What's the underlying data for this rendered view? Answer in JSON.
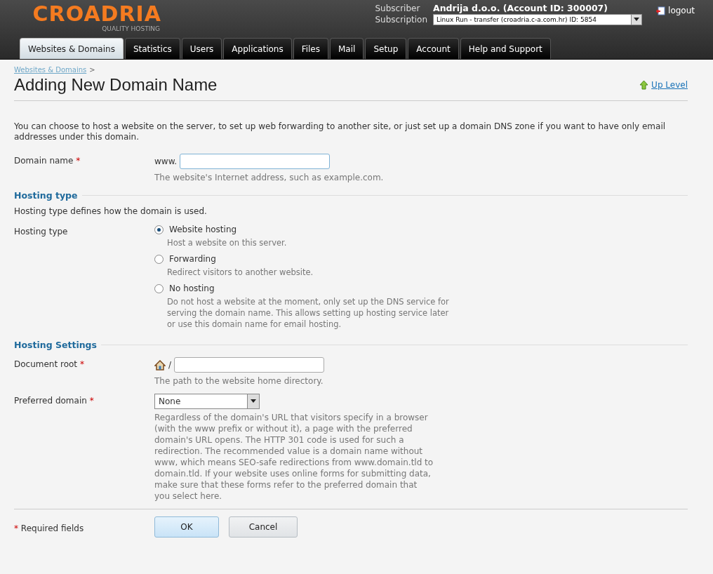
{
  "header": {
    "logo": "CROADRIA",
    "tagline": "QUALITY HOSTING",
    "subscriber_label": "Subscriber",
    "subscriber": "Andrija d.o.o. (Account ID: 300007)",
    "subscription_label": "Subscription",
    "subscription": "Linux Run - transfer (croadria.c-a.com.hr) ID: 5854",
    "logout": "logout"
  },
  "tabs": [
    {
      "label": "Websites & Domains",
      "selected": true
    },
    {
      "label": "Statistics",
      "selected": false
    },
    {
      "label": "Users",
      "selected": false
    },
    {
      "label": "Applications",
      "selected": false
    },
    {
      "label": "Files",
      "selected": false
    },
    {
      "label": "Mail",
      "selected": false
    },
    {
      "label": "Setup",
      "selected": false
    },
    {
      "label": "Account",
      "selected": false
    },
    {
      "label": "Help and Support",
      "selected": false
    }
  ],
  "breadcrumb": {
    "link": "Websites & Domains",
    "separator": ">"
  },
  "title": "Adding New Domain Name",
  "up_level": "Up Level",
  "intro": "You can choose to host a website on the server, to set up web forwarding to another site, or just set up a domain DNS zone if you want to have only email addresses under this domain.",
  "sections": [
    {
      "rows": [
        {
          "kind": "text",
          "label": "Domain name",
          "required": true,
          "prefix": "www.",
          "hint": "The website's Internet address, such as example.com."
        }
      ]
    },
    {
      "title": "Hosting type",
      "description": "Hosting type defines how the domain is used.",
      "rows": [
        {
          "kind": "radio",
          "label": "Hosting type",
          "required": false,
          "options": [
            {
              "label": "Website hosting",
              "selected": true,
              "hint": "Host a website on this server."
            },
            {
              "label": "Forwarding",
              "selected": false,
              "hint": "Redirect visitors to another website."
            },
            {
              "label": "No hosting",
              "selected": false,
              "hint": "Do not host a website at the moment, only set up the DNS service for serving the domain name. This allows setting up hosting service later or use this domain name for email hosting."
            }
          ]
        }
      ]
    },
    {
      "title": "Hosting Settings",
      "rows": [
        {
          "kind": "path",
          "label": "Document root",
          "required": true,
          "prefix": "/",
          "hint": "The path to the website home directory."
        },
        {
          "kind": "select",
          "label": "Preferred domain",
          "required": true,
          "value": "None",
          "hint": "Regardless of the domain's URL that visitors specify in a browser (with the www prefix or without it), a page with the preferred domain's URL opens. The HTTP 301 code is used for such a redirection. The recommended value is a domain name without www, which means SEO-safe redirections from www.domain.tld to domain.tld. If your website uses online forms for submitting data, make sure that these forms refer to the preferred domain that you select here."
        }
      ]
    }
  ],
  "footer": {
    "required_mark": "*",
    "required_note": "Required fields",
    "buttons": [
      {
        "label": "OK",
        "kind": "primary"
      },
      {
        "label": "Cancel",
        "kind": "secondary"
      }
    ]
  }
}
